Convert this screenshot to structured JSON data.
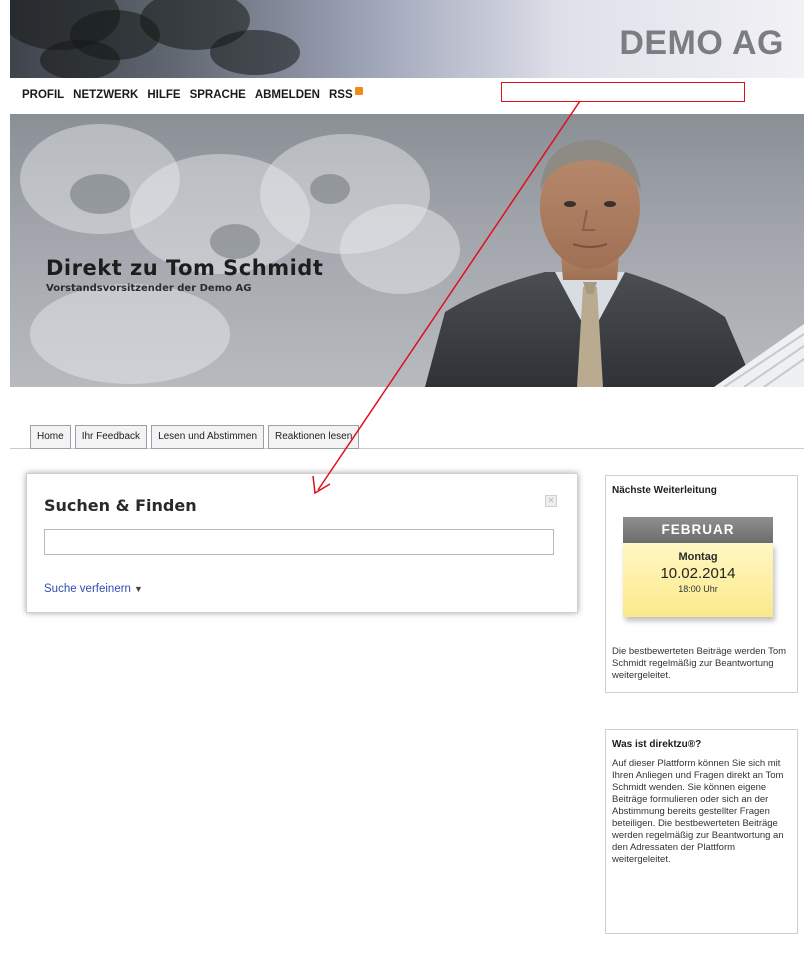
{
  "brand": {
    "name": "DEMO AG"
  },
  "nav": {
    "items": [
      "PROFIL",
      "NETZWERK",
      "HILFE",
      "SPRACHE",
      "ABMELDEN"
    ],
    "rss_label": "RSS"
  },
  "hero": {
    "title": "Direkt zu Tom Schmidt",
    "subtitle": "Vorstandsvorsitzender der Demo AG"
  },
  "tabs": [
    "Home",
    "Ihr Feedback",
    "Lesen und Abstimmen",
    "Reaktionen lesen"
  ],
  "search": {
    "title": "Suchen & Finden",
    "input_value": "",
    "refine_label": "Suche verfeinern"
  },
  "forwarding": {
    "title": "Nächste Weiterleitung",
    "month": "FEBRUAR",
    "weekday": "Montag",
    "date": "10.02.2014",
    "time": "18:00 Uhr",
    "text": "Die bestbewerteten Beiträge werden Tom Schmidt regelmäßig zur Beantwortung weitergeleitet."
  },
  "about": {
    "title": "Was ist direktzu®?",
    "text": "Auf dieser Plattform können Sie sich mit Ihren Anliegen und Fragen direkt an Tom Schmidt wenden. Sie können eigene Beiträge formulieren oder sich an der Abstimmung bereits gestellter Fragen beteiligen. Die bestbewerteten Beiträge werden regelmäßig zur Beantwortung an den Adressaten der Plattform weitergeleitet."
  },
  "colors": {
    "annotation": "#e0101a",
    "link": "#2f4db3",
    "rss": "#f08a1c"
  }
}
